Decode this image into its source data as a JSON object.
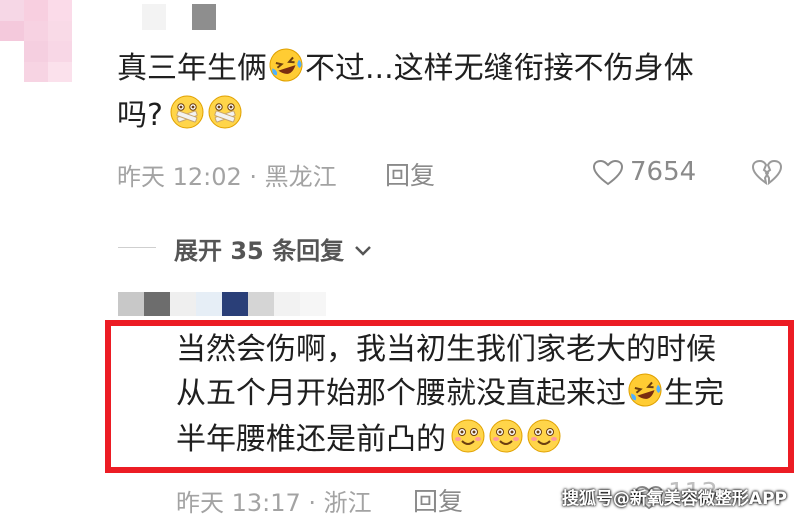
{
  "comment": {
    "text_line1": "真三年生俩",
    "text_line1_after": "不过...这样无缝衔接不伤身体",
    "text_line2": "吗?",
    "meta": "昨天 12:02 · 黑龙江",
    "reply_label": "回复",
    "like_count": "7654"
  },
  "replies_toggle": {
    "label": "展开 35 条回复"
  },
  "reply": {
    "line1": "当然会伤啊，我当初生我们家老大的时候",
    "line2_before": "从五个月开始那个腰就没直起来过",
    "line2_after": "生完",
    "line3": "半年腰椎还是前凸的",
    "meta": "昨天 13:17 · 浙江",
    "reply_label": "回复",
    "like_count": "113"
  },
  "watermark": "搜狐号@新氧美容微整形APP",
  "colors": {
    "highlight_border": "#ec1c24",
    "meta_gray": "#a3a3a3",
    "emoji_yellow": "#ffcc33"
  },
  "icons": [
    "heart-outline-icon",
    "broken-heart-icon",
    "chevron-down-icon",
    "laughing-tears-emoji",
    "mouth-taped-emoji",
    "blushing-smile-emoji"
  ]
}
